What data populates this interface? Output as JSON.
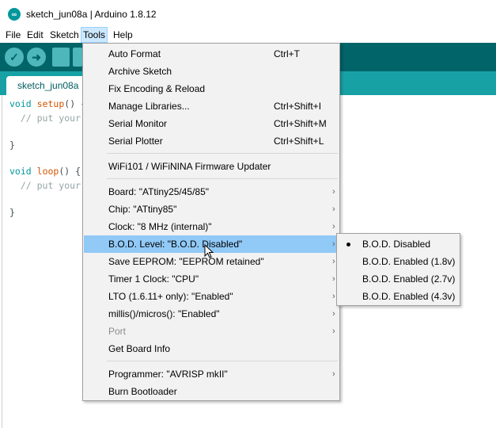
{
  "window": {
    "title": "sketch_jun08a | Arduino 1.8.12",
    "icon": "arduino-logo-icon"
  },
  "menubar": [
    "File",
    "Edit",
    "Sketch",
    "Tools",
    "Help"
  ],
  "tab": {
    "label": "sketch_jun08a"
  },
  "code": {
    "setup_kw": "void",
    "setup_fn": "setup",
    "setup_rest": "() {",
    "setup_comment": "  // put your",
    "close1": "}",
    "loop_kw": "void",
    "loop_fn": "loop",
    "loop_rest": "() {",
    "loop_comment": "  // put your",
    "close2": "}"
  },
  "tools_menu": {
    "items": [
      {
        "label": "Auto Format",
        "shortcut": "Ctrl+T"
      },
      {
        "label": "Archive Sketch",
        "shortcut": ""
      },
      {
        "label": "Fix Encoding & Reload",
        "shortcut": ""
      },
      {
        "label": "Manage Libraries...",
        "shortcut": "Ctrl+Shift+I"
      },
      {
        "label": "Serial Monitor",
        "shortcut": "Ctrl+Shift+M"
      },
      {
        "label": "Serial Plotter",
        "shortcut": "Ctrl+Shift+L"
      },
      {
        "label": "WiFi101 / WiFiNINA Firmware Updater",
        "shortcut": ""
      },
      {
        "label": "Board: \"ATtiny25/45/85\"",
        "shortcut": ""
      },
      {
        "label": "Chip: \"ATtiny85\"",
        "shortcut": ""
      },
      {
        "label": "Clock: \"8 MHz (internal)\"",
        "shortcut": ""
      },
      {
        "label": "B.O.D. Level: \"B.O.D. Disabled\"",
        "shortcut": ""
      },
      {
        "label": "Save EEPROM: \"EEPROM retained\"",
        "shortcut": ""
      },
      {
        "label": "Timer 1 Clock: \"CPU\"",
        "shortcut": ""
      },
      {
        "label": "LTO (1.6.11+ only): \"Enabled\"",
        "shortcut": ""
      },
      {
        "label": "millis()/micros(): \"Enabled\"",
        "shortcut": ""
      },
      {
        "label": "Port",
        "shortcut": ""
      },
      {
        "label": "Get Board Info",
        "shortcut": ""
      },
      {
        "label": "Programmer: \"AVRISP mkII\"",
        "shortcut": ""
      },
      {
        "label": "Burn Bootloader",
        "shortcut": ""
      }
    ]
  },
  "bod_submenu": {
    "items": [
      {
        "label": "B.O.D. Disabled",
        "selected": true
      },
      {
        "label": "B.O.D. Enabled (1.8v)",
        "selected": false
      },
      {
        "label": "B.O.D. Enabled (2.7v)",
        "selected": false
      },
      {
        "label": "B.O.D. Enabled (4.3v)",
        "selected": false
      }
    ]
  },
  "colors": {
    "toolbar": "#006468",
    "tabbar": "#17a1a5",
    "highlight": "#91c9f7"
  }
}
